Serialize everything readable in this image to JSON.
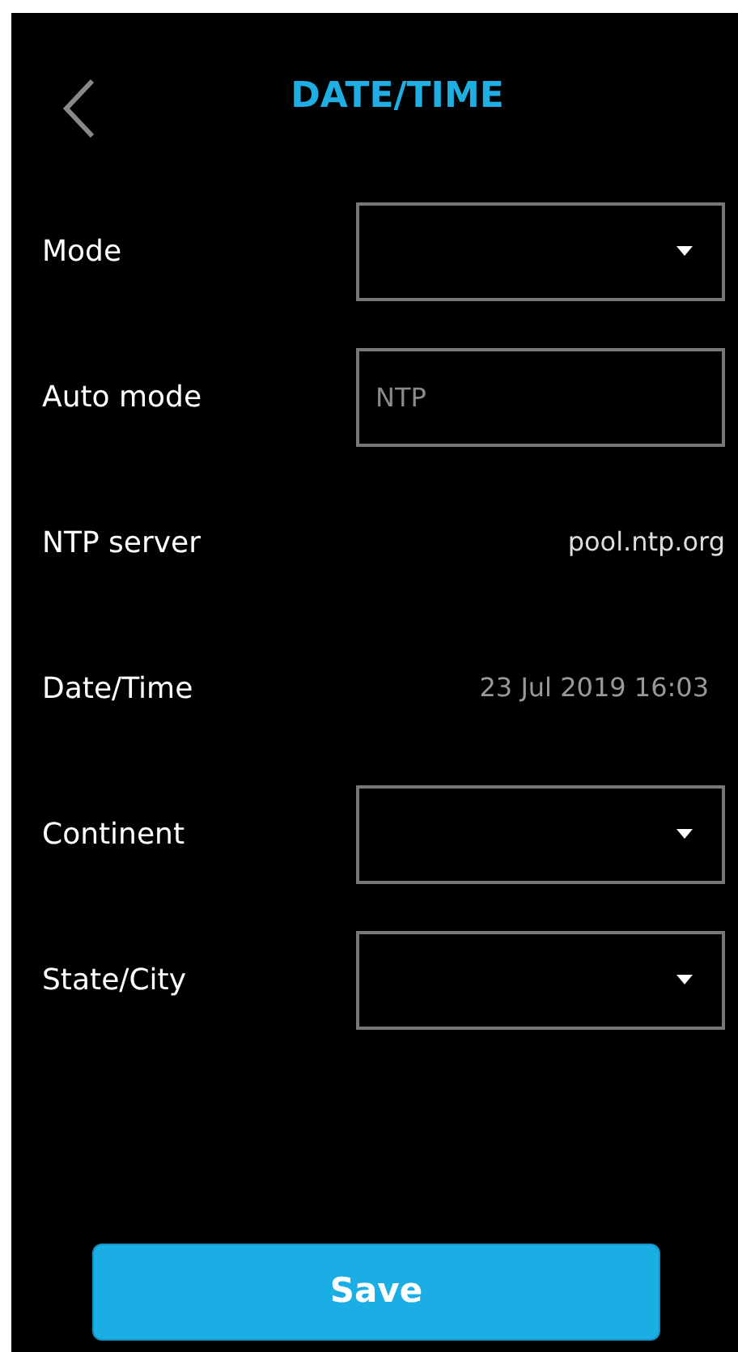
{
  "header": {
    "title": "DATE/TIME"
  },
  "rows": [
    {
      "label": "Mode",
      "kind": "select"
    },
    {
      "label": "Auto mode",
      "kind": "input",
      "value": "NTP"
    },
    {
      "label": "NTP server",
      "kind": "value",
      "value": "pool.ntp.org",
      "muted": false
    },
    {
      "label": "Date/Time",
      "kind": "value",
      "value": "23 Jul 2019 16:03",
      "muted": true
    },
    {
      "label": "Continent",
      "kind": "select"
    },
    {
      "label": "State/City",
      "kind": "select"
    }
  ],
  "save_button": "Save"
}
